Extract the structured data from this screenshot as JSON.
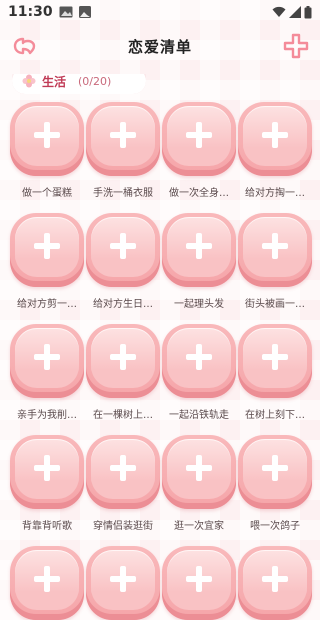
{
  "status_bar": {
    "time": "11:30"
  },
  "header": {
    "title": "恋爱清单"
  },
  "category": {
    "name": "生活",
    "count": "(0/20)"
  },
  "items": [
    {
      "label": "做一个蛋糕"
    },
    {
      "label": "手洗一桶衣服"
    },
    {
      "label": "做一次全身…"
    },
    {
      "label": "给对方掏一…"
    },
    {
      "label": "给对方剪一…"
    },
    {
      "label": "给对方生日…"
    },
    {
      "label": "一起理头发"
    },
    {
      "label": "街头被画一…"
    },
    {
      "label": "亲手为我削…"
    },
    {
      "label": "在一棵树上…"
    },
    {
      "label": "一起沿铁轨走"
    },
    {
      "label": "在树上刻下…"
    },
    {
      "label": "背靠背听歌"
    },
    {
      "label": "穿情侣装逛街"
    },
    {
      "label": "逛一次宜家"
    },
    {
      "label": "喂一次鸽子"
    },
    {
      "label": ""
    },
    {
      "label": ""
    },
    {
      "label": ""
    },
    {
      "label": ""
    }
  ],
  "colors": {
    "accent": "#f48c9a",
    "tile": "#f9b9bb",
    "title": "#222222"
  }
}
